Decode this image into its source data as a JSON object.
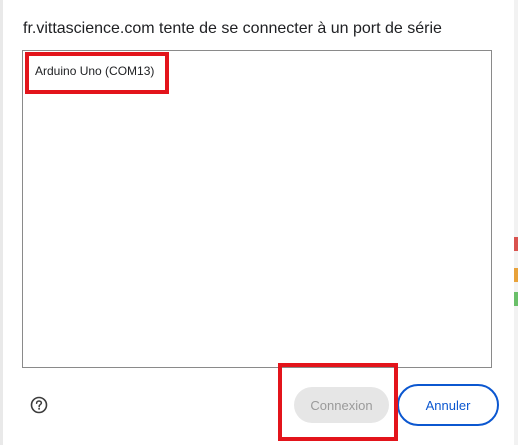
{
  "dialog": {
    "title": "fr.vittascience.com tente de se connecter à un port de série",
    "devices": [
      {
        "label": "Arduino Uno (COM13)"
      }
    ],
    "help_icon": "help-circle-icon",
    "buttons": {
      "connect_label": "Connexion",
      "cancel_label": "Annuler"
    }
  },
  "colors": {
    "accent": "#0b57d0",
    "annotation": "#e3141b",
    "disabled_bg": "#e6e6e6",
    "disabled_text": "#9a9a9a",
    "background_edge_marks": [
      "#d9534f",
      "#6abf69",
      "#e8a23a"
    ]
  }
}
